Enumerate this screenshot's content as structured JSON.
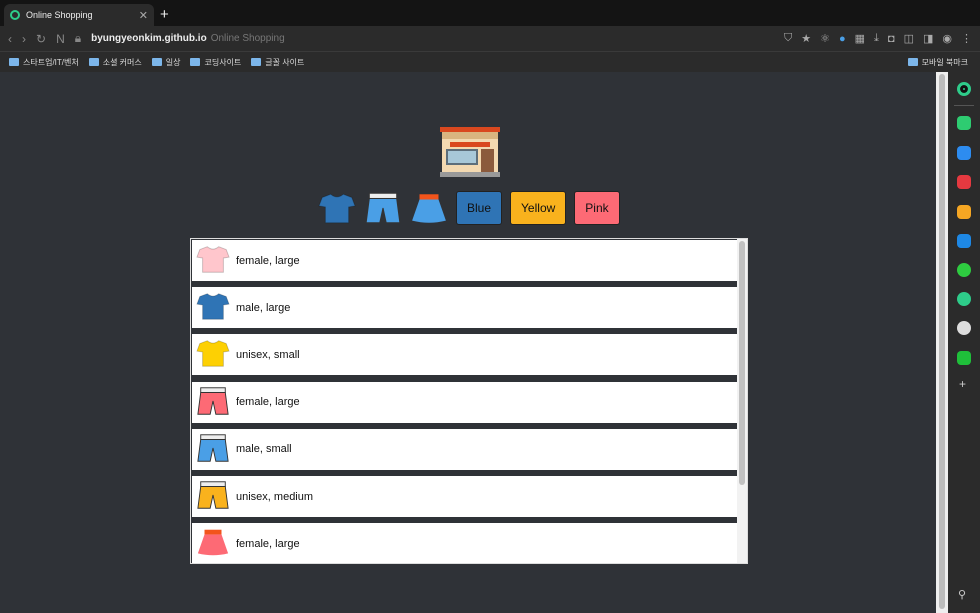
{
  "browser": {
    "tab_title": "Online Shopping",
    "url_host": "byungyeonkim.github.io",
    "url_title": "Online Shopping",
    "bookmarks": [
      "스타트업/IT/벤처",
      "소셜 커머스",
      "일상",
      "코딩사이트",
      "글꼴 사이트"
    ],
    "bookmark_right": "모바일 북마크"
  },
  "filters": {
    "icons": [
      {
        "type": "tshirt",
        "color": "#2f74b5"
      },
      {
        "type": "pants",
        "color": "#4a9fe6"
      },
      {
        "type": "skirt",
        "color": "#4a9fe6"
      }
    ],
    "buttons": [
      {
        "label": "Blue",
        "color": "#2f74b5"
      },
      {
        "label": "Yellow",
        "color": "#f9b21d"
      },
      {
        "label": "Pink",
        "color": "#fd6a75"
      }
    ]
  },
  "items": [
    {
      "type": "tshirt",
      "color": "#ffc6cc",
      "label": "female, large"
    },
    {
      "type": "tshirt",
      "color": "#2f74b5",
      "label": "male, large"
    },
    {
      "type": "tshirt",
      "color": "#fdd003",
      "label": "unisex, small"
    },
    {
      "type": "pants",
      "color": "#fd6a75",
      "label": "female, large"
    },
    {
      "type": "pants",
      "color": "#4a9fe6",
      "label": "male, small"
    },
    {
      "type": "pants",
      "color": "#f9b21d",
      "label": "unisex, medium"
    },
    {
      "type": "skirt",
      "color": "#fd6a75",
      "label": "female, large"
    }
  ]
}
